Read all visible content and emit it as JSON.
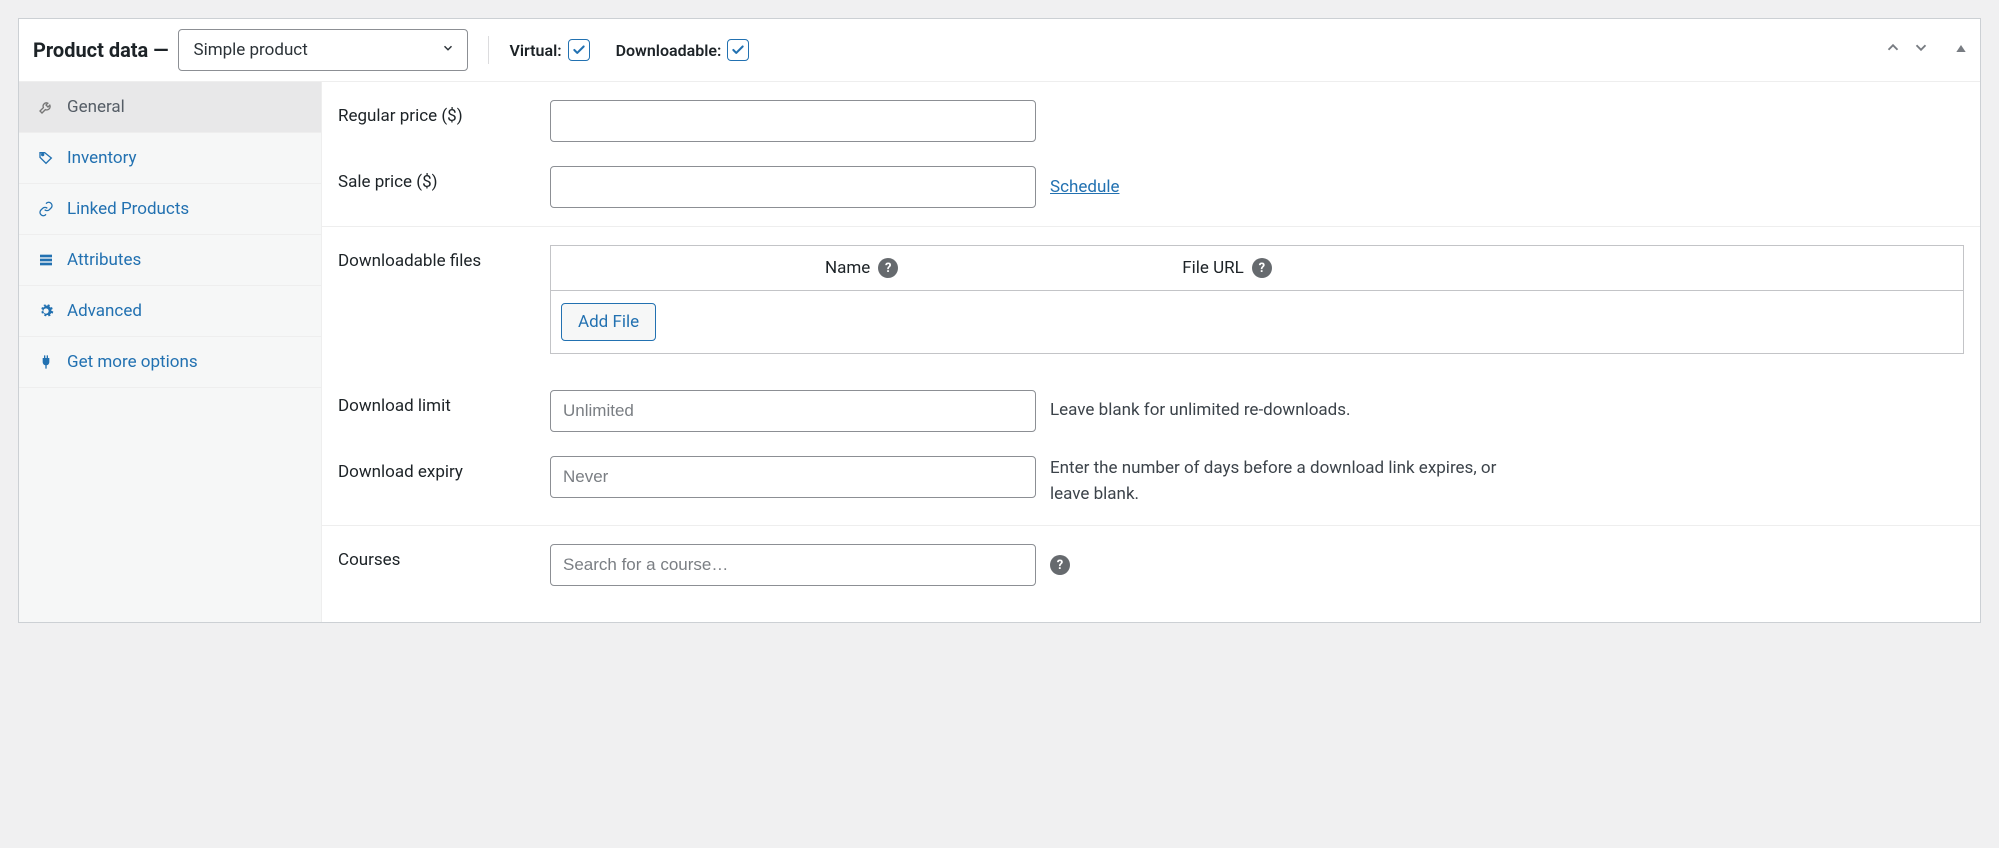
{
  "header": {
    "title_prefix": "Product data —",
    "product_type": "Simple product",
    "virtual_label": "Virtual:",
    "virtual_checked": true,
    "downloadable_label": "Downloadable:",
    "downloadable_checked": true
  },
  "sidebar": {
    "items": [
      {
        "id": "general",
        "label": "General",
        "active": true
      },
      {
        "id": "inventory",
        "label": "Inventory",
        "active": false
      },
      {
        "id": "linked",
        "label": "Linked Products",
        "active": false
      },
      {
        "id": "attributes",
        "label": "Attributes",
        "active": false
      },
      {
        "id": "advanced",
        "label": "Advanced",
        "active": false
      },
      {
        "id": "getmore",
        "label": "Get more options",
        "active": false
      }
    ]
  },
  "form": {
    "regular_price_label": "Regular price ($)",
    "regular_price_value": "",
    "sale_price_label": "Sale price ($)",
    "sale_price_value": "",
    "schedule_link": "Schedule",
    "downloadable_files_label": "Downloadable files",
    "dl_col_name": "Name",
    "dl_col_url": "File URL",
    "add_file_button": "Add File",
    "download_limit_label": "Download limit",
    "download_limit_placeholder": "Unlimited",
    "download_limit_value": "",
    "download_limit_help": "Leave blank for unlimited re-downloads.",
    "download_expiry_label": "Download expiry",
    "download_expiry_placeholder": "Never",
    "download_expiry_value": "",
    "download_expiry_help": "Enter the number of days before a download link expires, or leave blank.",
    "courses_label": "Courses",
    "courses_placeholder": "Search for a course…",
    "courses_value": ""
  }
}
